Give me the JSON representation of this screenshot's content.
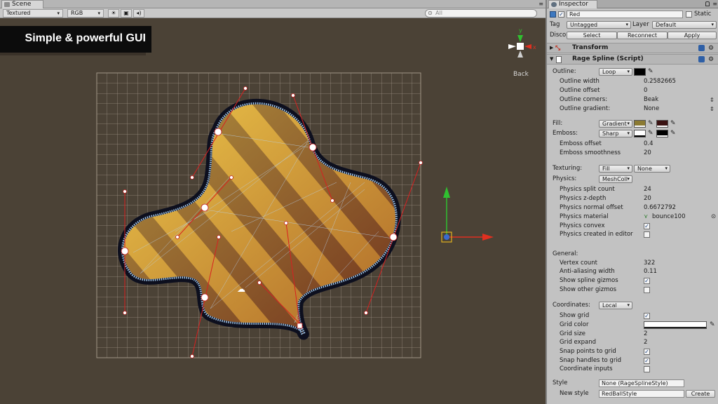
{
  "scene": {
    "tab_label": "Scene",
    "toolbar": {
      "render_mode": "Textured",
      "color_mode": "RGB",
      "lighting_icon": "sun-icon",
      "image_icon": "image-icon",
      "audio_icon": "speaker-icon",
      "search_placeholder": "All"
    },
    "banner_text": "Simple & powerful GUI",
    "gizmo": {
      "y_label": "y",
      "x_label": "x",
      "view_label": "Back"
    }
  },
  "inspector": {
    "tab_label": "Inspector",
    "object_name": "Red",
    "static_label": "Static",
    "tag_label": "Tag",
    "tag_value": "Untagged",
    "layer_label": "Layer",
    "layer_value": "Default",
    "prefab_label": "Discor",
    "select_label": "Select",
    "reconnect_label": "Reconnect",
    "apply_label": "Apply",
    "transform_label": "Transform",
    "script_label": "Rage Spline (Script)",
    "outline": {
      "label": "Outline:",
      "mode": "Loop",
      "color": "#000000",
      "width_label": "Outline width",
      "width_value": "0.2582665",
      "offset_label": "Outline offset",
      "offset_value": "0",
      "corners_label": "Outline corners:",
      "corners_value": "Beak",
      "gradient_label": "Outline gradient:",
      "gradient_value": "None"
    },
    "fill": {
      "label": "Fill:",
      "mode": "Gradient",
      "color1": "#8b7a32",
      "color2": "#3a1212"
    },
    "emboss": {
      "label": "Emboss:",
      "mode": "Sharp",
      "color1": "#ffffff",
      "color2": "#000000",
      "offset_label": "Emboss offset",
      "offset_value": "0.4",
      "smoothness_label": "Emboss smoothness",
      "smoothness_value": "20"
    },
    "texturing": {
      "label": "Texturing:",
      "mode1": "Fill",
      "mode2": "None"
    },
    "physics": {
      "label": "Physics:",
      "mode": "MeshColl",
      "split_label": "Physics split count",
      "split_value": "24",
      "zdepth_label": "Physics z-depth",
      "zdepth_value": "20",
      "normal_label": "Physics normal offset",
      "normal_value": "0.6672792",
      "material_label": "Physics material",
      "material_value": "bounce100",
      "convex_label": "Physics convex",
      "convex_checked": true,
      "editor_label": "Physics created in editor",
      "editor_checked": false
    },
    "general": {
      "label": "General:",
      "vertex_label": "Vertex count",
      "vertex_value": "322",
      "aa_label": "Anti-aliasing width",
      "aa_value": "0.11",
      "spline_gizmos_label": "Show spline gizmos",
      "spline_gizmos_checked": true,
      "other_gizmos_label": "Show other gizmos",
      "other_gizmos_checked": false
    },
    "coordinates": {
      "label": "Coordinates:",
      "mode": "Local",
      "show_grid_label": "Show grid",
      "show_grid_checked": true,
      "grid_color_label": "Grid color",
      "grid_color": "#ffffff",
      "grid_size_label": "Grid size",
      "grid_size_value": "2",
      "grid_expand_label": "Grid expand",
      "grid_expand_value": "2",
      "snap_points_label": "Snap points to grid",
      "snap_points_checked": true,
      "snap_handles_label": "Snap handles to grid",
      "snap_handles_checked": true,
      "coord_inputs_label": "Coordinate inputs",
      "coord_inputs_checked": false
    },
    "style": {
      "label": "Style",
      "value": "None (RageSplineStyle)",
      "new_label": "New style",
      "new_value": "RedBallStyle",
      "create_label": "Create"
    }
  }
}
